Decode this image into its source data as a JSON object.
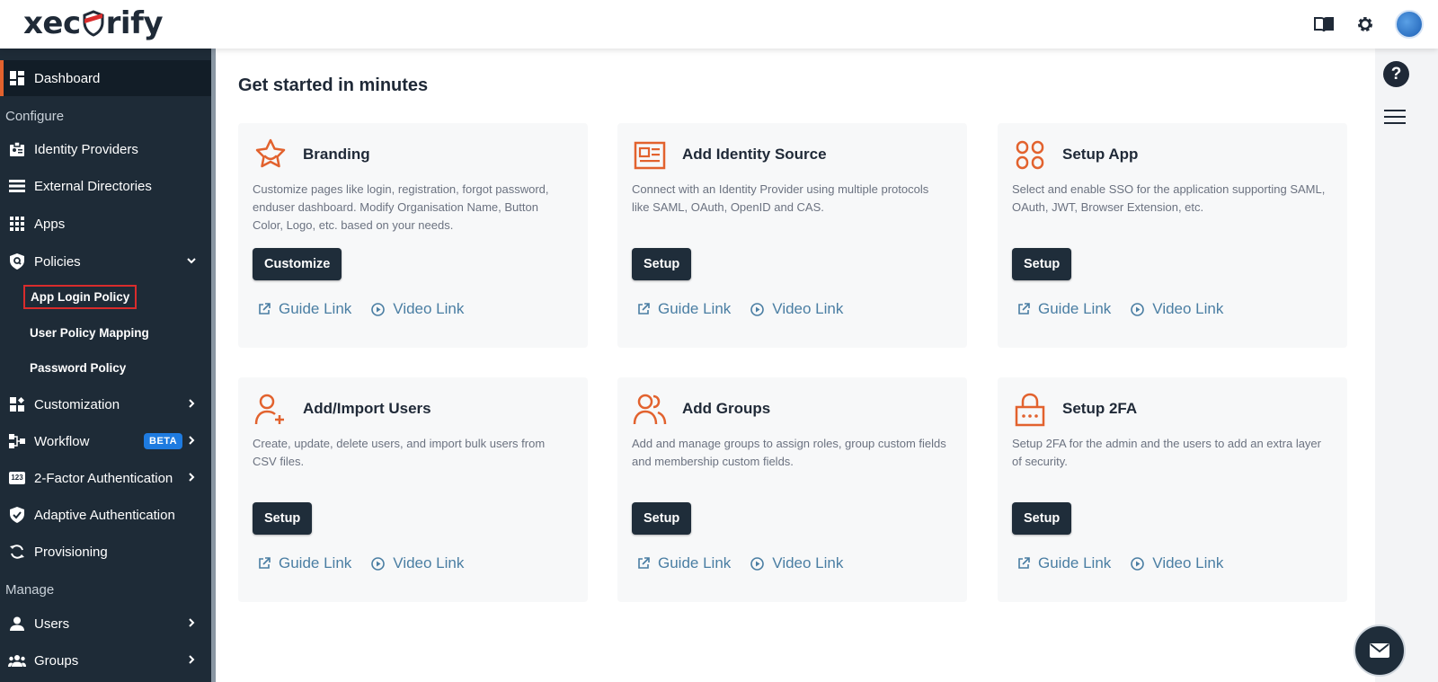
{
  "header": {
    "logo_text_before": "xec",
    "logo_text_after": "rify"
  },
  "sidebar": {
    "dashboard": "Dashboard",
    "configure_label": "Configure",
    "identity_providers": "Identity Providers",
    "external_directories": "External Directories",
    "apps": "Apps",
    "policies": "Policies",
    "app_login_policy": "App Login Policy",
    "user_policy_mapping": "User Policy Mapping",
    "password_policy": "Password Policy",
    "customization": "Customization",
    "workflow": "Workflow",
    "beta_badge": "BETA",
    "two_factor": "2-Factor Authentication",
    "adaptive": "Adaptive Authentication",
    "provisioning": "Provisioning",
    "manage_label": "Manage",
    "users": "Users",
    "groups": "Groups",
    "two_factor_icon_text": "123"
  },
  "main": {
    "title": "Get started in minutes",
    "cards": [
      {
        "title": "Branding",
        "desc": "Customize pages like login, registration, forgot password, enduser dashboard. Modify Organisation Name, Button Color, Logo, etc. based on your needs.",
        "button": "Customize",
        "guide": "Guide Link",
        "video": "Video Link",
        "icon": "star-badge-icon"
      },
      {
        "title": "Add Identity Source",
        "desc": "Connect with an Identity Provider using multiple protocols like SAML, OAuth, OpenID and CAS.",
        "button": "Setup",
        "guide": "Guide Link",
        "video": "Video Link",
        "icon": "id-card-icon"
      },
      {
        "title": "Setup App",
        "desc": "Select and enable SSO for the application supporting SAML, OAuth, JWT, Browser Extension, etc.",
        "button": "Setup",
        "guide": "Guide Link",
        "video": "Video Link",
        "icon": "command-apps-icon"
      },
      {
        "title": "Add/Import Users",
        "desc": "Create, update, delete users, and import bulk users from CSV files.",
        "button": "Setup",
        "guide": "Guide Link",
        "video": "Video Link",
        "icon": "user-add-icon"
      },
      {
        "title": "Add Groups",
        "desc": "Add and manage groups to assign roles, group custom fields and membership custom fields.",
        "button": "Setup",
        "guide": "Guide Link",
        "video": "Video Link",
        "icon": "users-group-icon"
      },
      {
        "title": "Setup 2FA",
        "desc": "Setup 2FA for the admin and the users to add an extra layer of security.",
        "button": "Setup",
        "guide": "Guide Link",
        "video": "Video Link",
        "icon": "lock-icon"
      }
    ]
  },
  "rail": {
    "help_label": "?"
  },
  "colors": {
    "accent": "#e2622e",
    "sidebar_bg": "#1e2b37",
    "link": "#4a7ea3",
    "button_bg": "#1f2d3a",
    "beta": "#1e7be0"
  }
}
